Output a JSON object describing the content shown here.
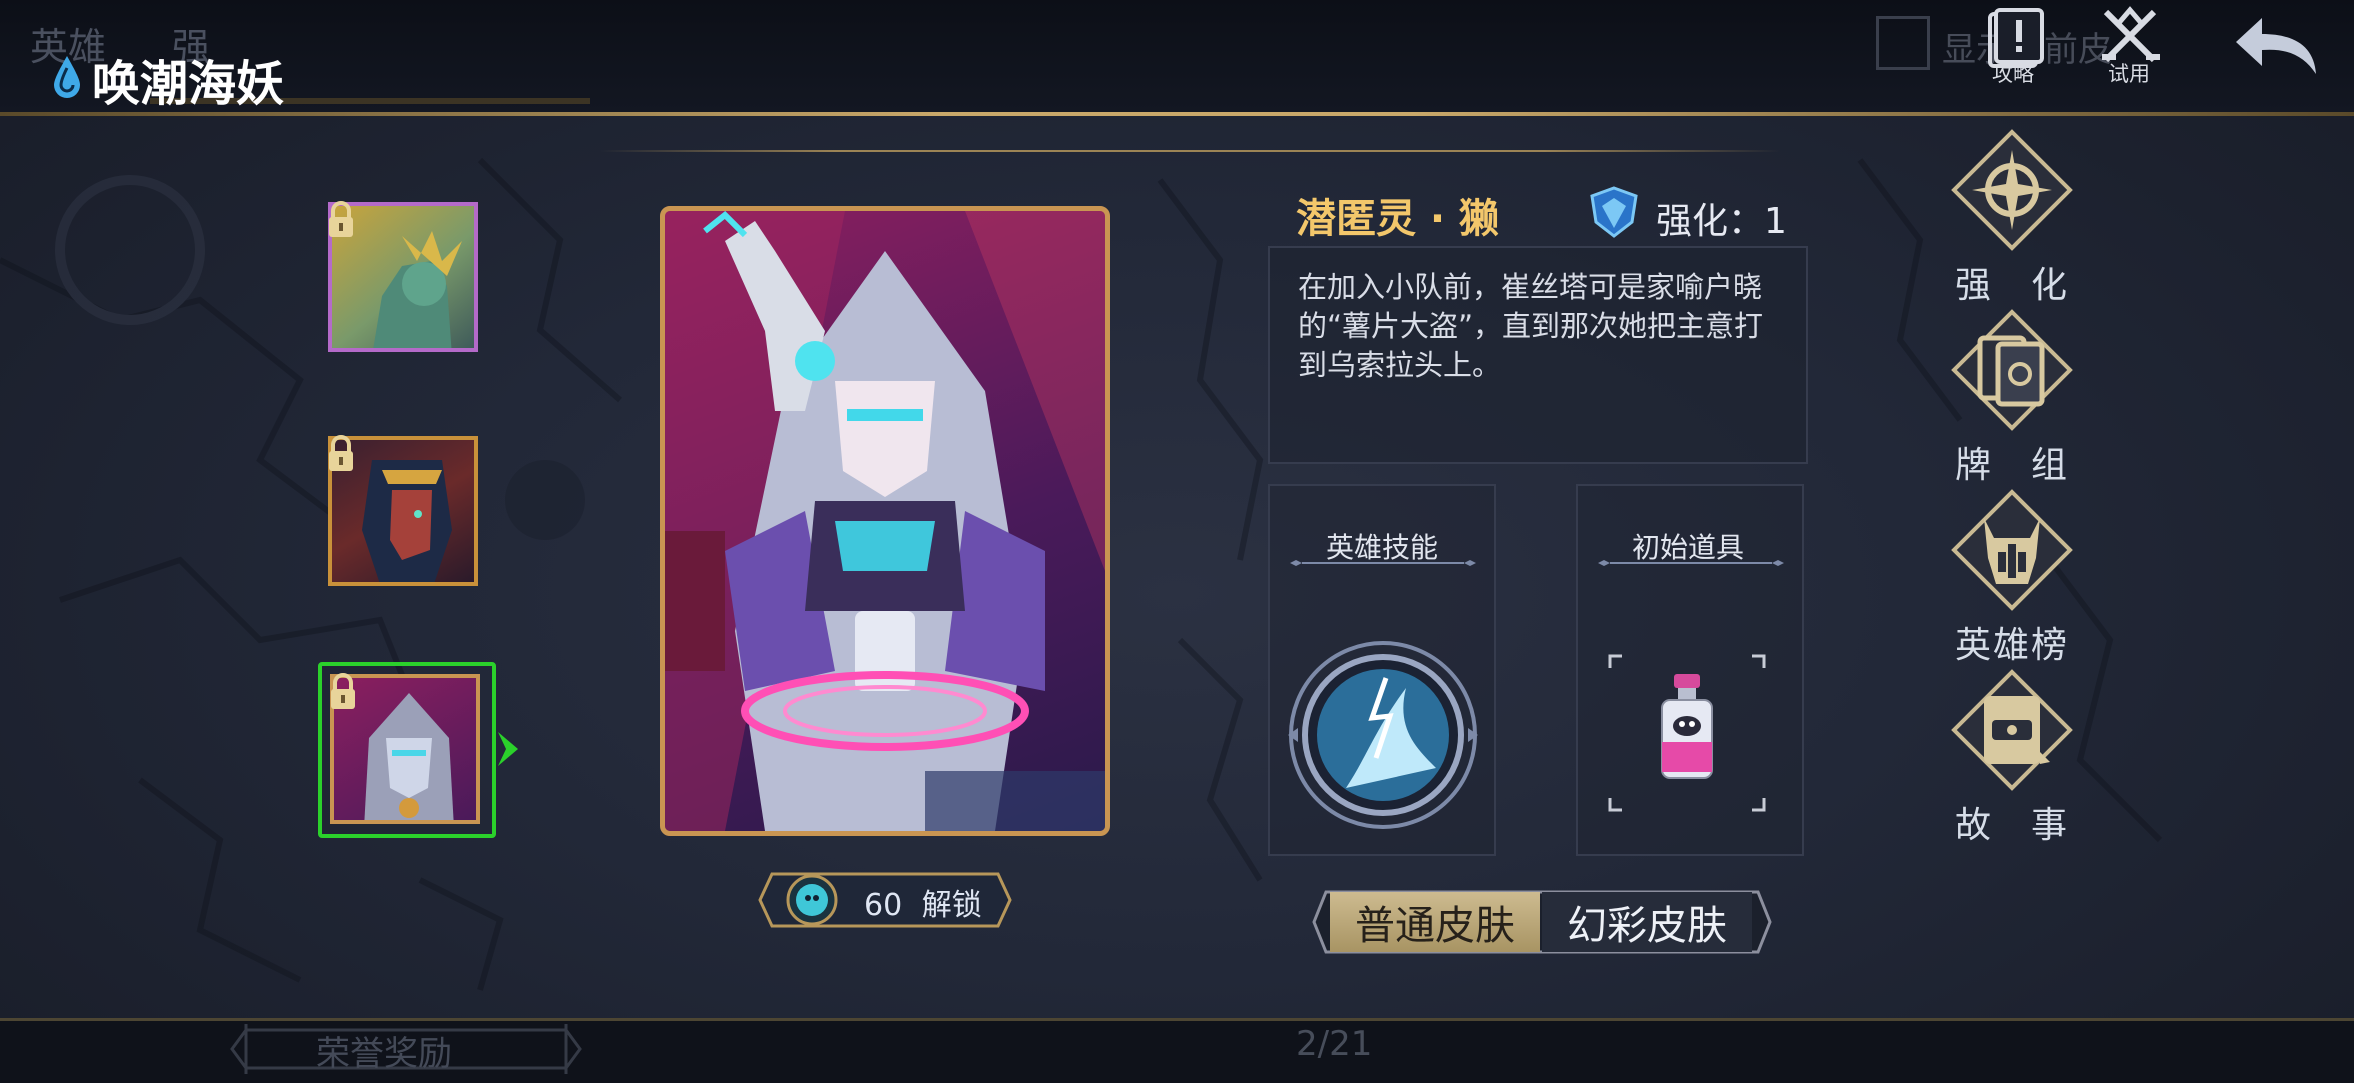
{
  "window": {
    "title": "唤潮海妖"
  },
  "header_background": {
    "tab_hero": "英雄",
    "tab_other": "强"
  },
  "top_controls": {
    "checkbox_label": "显示当前皮",
    "guide_label": "攻略",
    "trial_label": "试用"
  },
  "hero_list": {
    "items": [
      {
        "name": "hero-thumb-1",
        "locked": true,
        "border_color": "#b46ac9"
      },
      {
        "name": "hero-thumb-2",
        "locked": true,
        "border_color": "#c9913a"
      },
      {
        "name": "hero-thumb-3",
        "locked": true,
        "border_color": "#2bd12b",
        "selected": true
      }
    ]
  },
  "unlock": {
    "cost": "60",
    "label": "解锁"
  },
  "hero_info": {
    "skin_name": "潜匿灵 · 獭",
    "enhance_label": "强化：1",
    "description": "在加入小队前，崔丝塔可是家喻户晓的“薯片大盗”，直到那次她把主意打到乌索拉头上。",
    "skill_panel_title": "英雄技能",
    "item_panel_title": "初始道具"
  },
  "skin_toggle": {
    "normal": "普通皮肤",
    "fancy": "幻彩皮肤",
    "active": "normal"
  },
  "right_menu": [
    {
      "label": "强　化",
      "icon": "enhance-star-icon"
    },
    {
      "label": "牌　组",
      "icon": "card-deck-icon"
    },
    {
      "label": "英雄榜",
      "icon": "hero-ranking-icon"
    },
    {
      "label": "故　事",
      "icon": "story-book-icon"
    }
  ],
  "bottom": {
    "honor_reward": "荣誉奖励",
    "page_indicator": "2/21"
  },
  "colors": {
    "accent_gold": "#c9a86a",
    "name_gold": "#f3c76b",
    "select_green": "#2bd12b"
  }
}
